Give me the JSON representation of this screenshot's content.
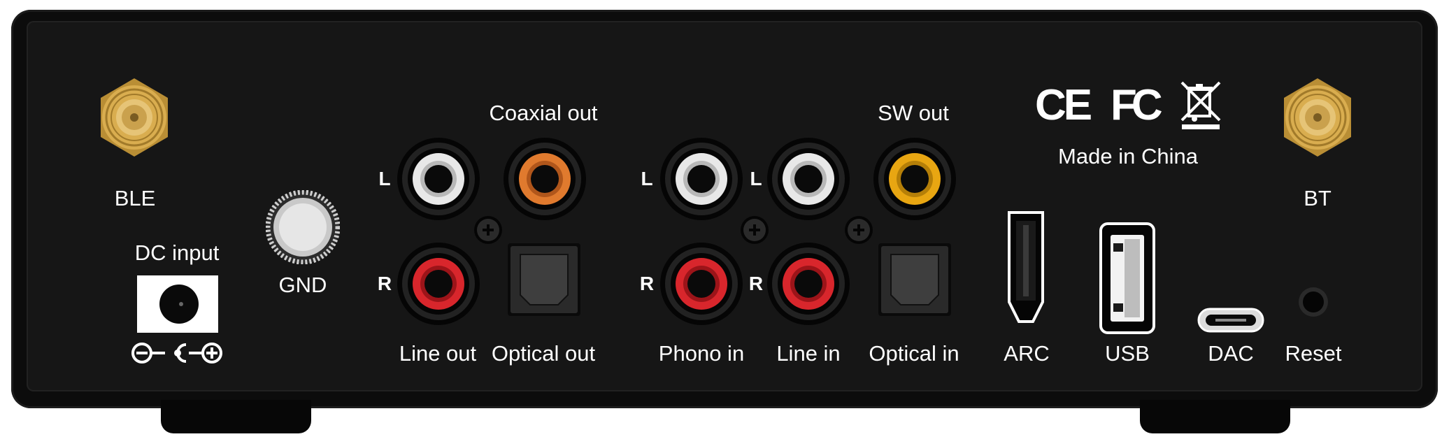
{
  "labels": {
    "ble": "BLE",
    "dc_input": "DC input",
    "gnd": "GND",
    "coaxial_out": "Coaxial out",
    "sw_out": "SW out",
    "made_in": "Made in China",
    "bt": "BT",
    "line_out": "Line out",
    "optical_out": "Optical out",
    "phono_in": "Phono in",
    "line_in": "Line in",
    "optical_in": "Optical in",
    "arc": "ARC",
    "usb": "USB",
    "dac": "DAC",
    "reset": "Reset"
  },
  "channels": {
    "left": "L",
    "right": "R"
  },
  "certifications": {
    "ce": "CE",
    "fcc": "FC"
  },
  "colors": {
    "chassis": "#0c0c0c",
    "panel": "#161616",
    "rca_white": "#e8e8e8",
    "rca_red": "#d8262c",
    "rca_orange": "#e07a2e",
    "rca_yellow": "#e8a612",
    "antenna_gold": "#d9ad4f",
    "text": "#ffffff"
  },
  "icons": {
    "antenna_ble": "sma-antenna-connector-icon",
    "antenna_bt": "sma-antenna-connector-icon",
    "dc_polarity": "center-positive-polarity-icon",
    "weee": "crossed-out-wheelie-bin-icon"
  }
}
